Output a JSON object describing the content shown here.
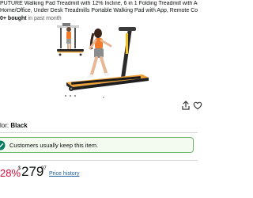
{
  "product": {
    "title_line1": "PUTURE Walking Pad Treadmill with 12% Incline, 6 in 1 Folding Treadmill with Adjustable Handle Bar",
    "title_line2": "Home/Office, Under Desk Treadmills Portable Walking Pad with App, Remote Control & LED Display",
    "bought_count": "0+ bought",
    "bought_suffix": " in past month"
  },
  "image": {
    "icon": "treadmill-product-photo",
    "accent_color": "#f0a33a",
    "frame_color": "#2a2a2a"
  },
  "actions": {
    "share_icon": "share-icon",
    "favorite_icon": "heart-icon"
  },
  "variant": {
    "label": "lor: ",
    "value": "Black"
  },
  "banner": {
    "text": "Customers usually keep this item.",
    "icon": "check-circle-icon",
    "color": "#067d62"
  },
  "price": {
    "discount": "28%",
    "symbol": "$",
    "whole": "279",
    "fraction": "97",
    "history_label": "Price history",
    "discount_color": "#cc0c39"
  }
}
